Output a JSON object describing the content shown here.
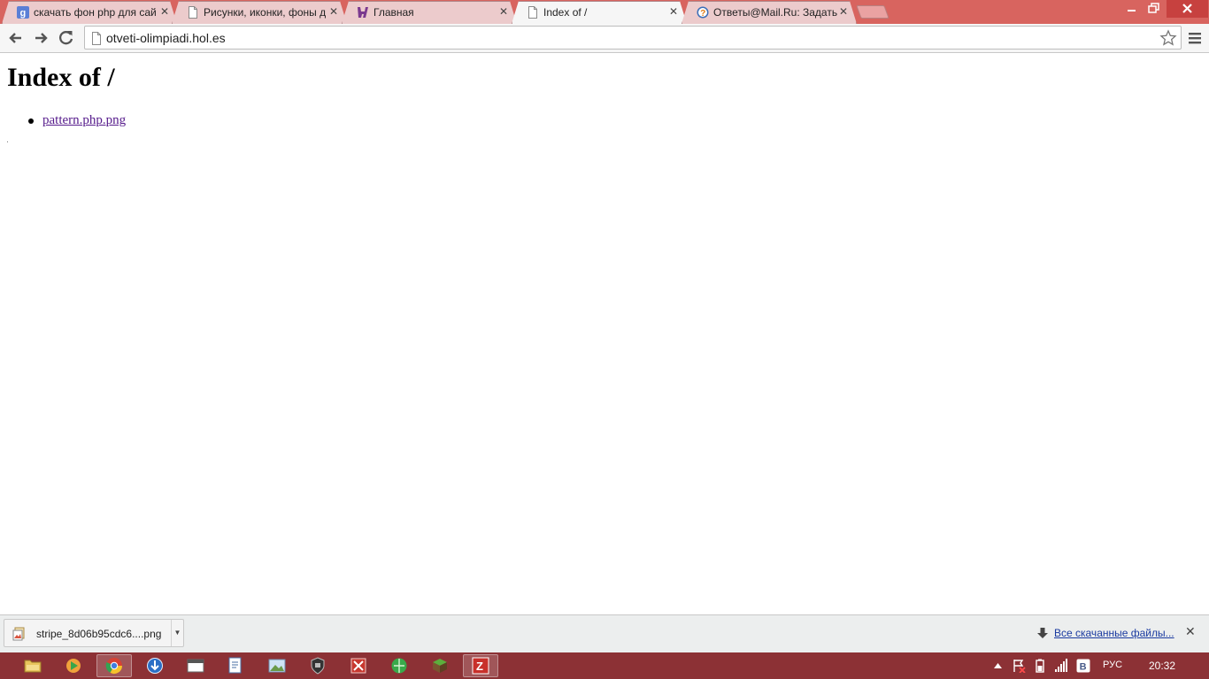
{
  "browser": {
    "tabs": [
      {
        "title": "скачать фон php для сай",
        "favicon": "google-icon",
        "state": "inactive"
      },
      {
        "title": "Рисунки, иконки, фоны д",
        "favicon": "page-icon",
        "state": "inactive"
      },
      {
        "title": "Главная",
        "favicon": "h-logo-icon",
        "state": "inactive"
      },
      {
        "title": "Index of /",
        "favicon": "page-icon",
        "state": "active"
      },
      {
        "title": "Ответы@Mail.Ru: Задать",
        "favicon": "question-icon",
        "state": "inactive"
      }
    ],
    "address": "otveti-olimpiadi.hol.es"
  },
  "page": {
    "heading": "Index of /",
    "links": [
      {
        "label": "pattern.php.png"
      }
    ]
  },
  "downloads": {
    "item": {
      "filename": "stripe_8d06b95cdc6....png"
    },
    "all_files_label": "Все скачанные файлы..."
  },
  "taskbar": {
    "language": "РУС",
    "time": "20:32"
  },
  "colors": {
    "tabstrip": "#d8645f",
    "taskbar": "#8c3135",
    "visited_link": "#551a8b"
  }
}
